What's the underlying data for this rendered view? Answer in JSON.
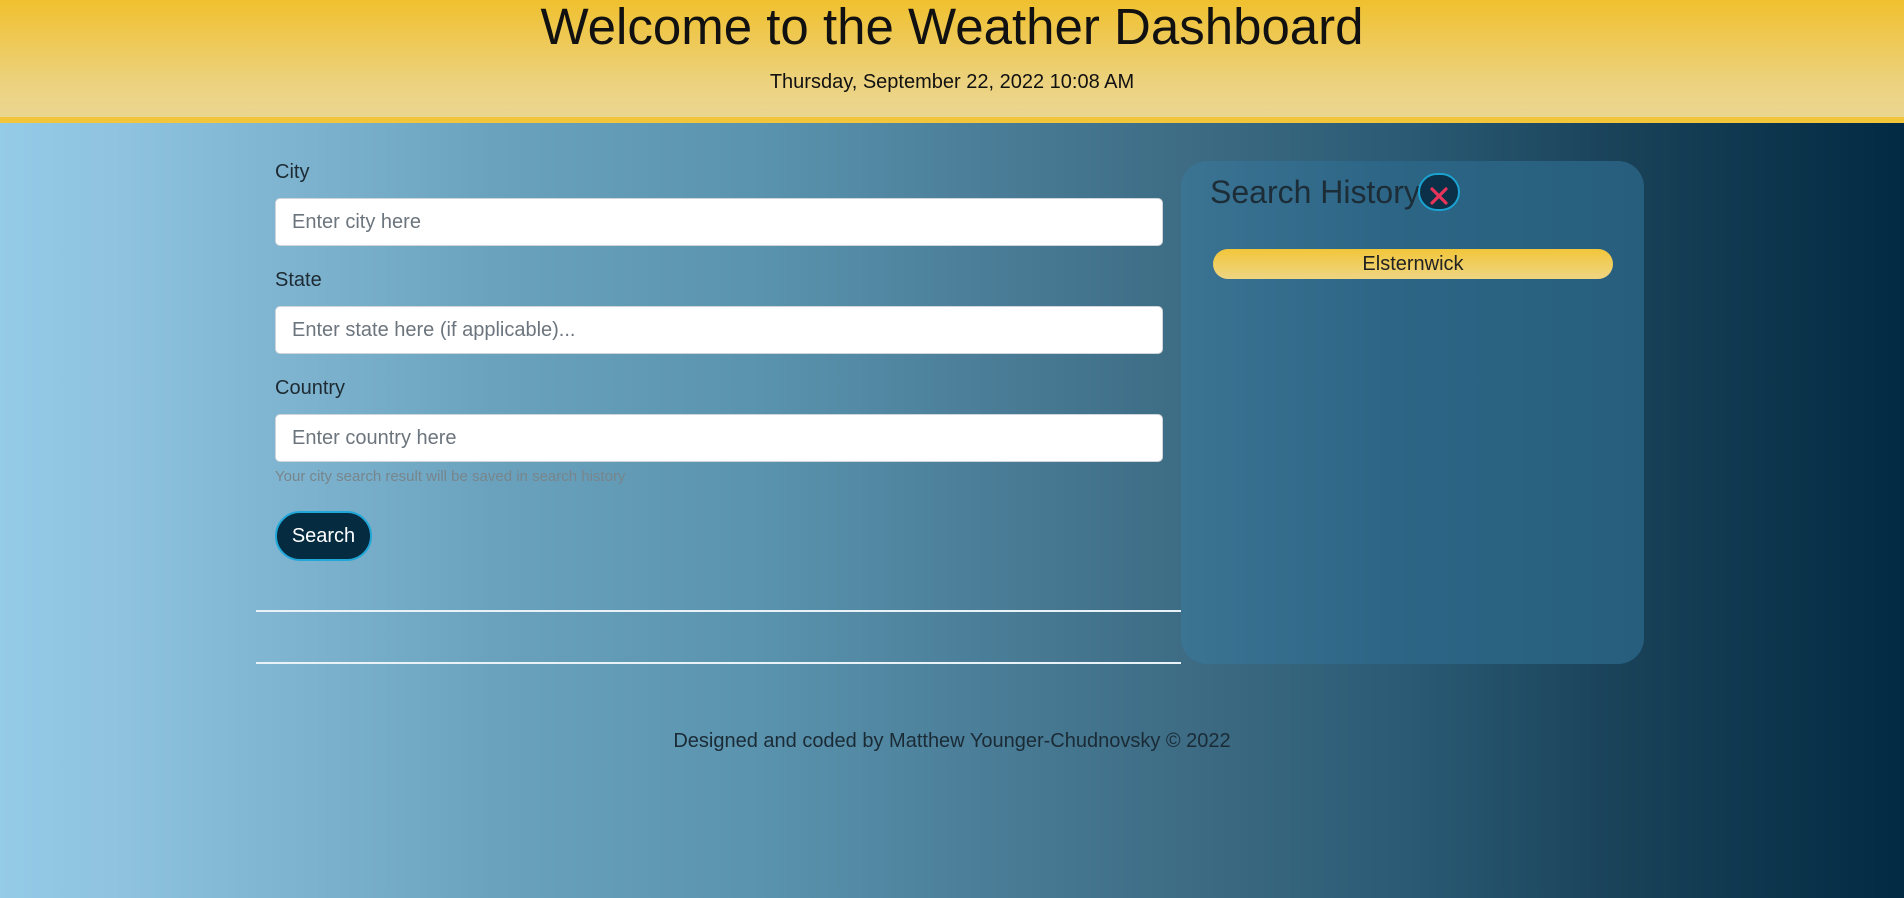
{
  "header": {
    "title": "Welcome to the Weather Dashboard",
    "datetime": "Thursday, September 22, 2022 10:08 AM"
  },
  "form": {
    "city": {
      "label": "City",
      "placeholder": "Enter city here",
      "value": ""
    },
    "state": {
      "label": "State",
      "placeholder": "Enter state here (if applicable)...",
      "value": ""
    },
    "country": {
      "label": "Country",
      "placeholder": "Enter country here",
      "value": ""
    },
    "help_text": "Your city search result will be saved in search history",
    "search_label": "Search"
  },
  "history": {
    "title": "Search History",
    "clear_icon": "close-icon",
    "items": [
      {
        "label": "Elsternwick"
      }
    ]
  },
  "footer": {
    "text": "Designed and coded by Matthew Younger-Chudnovsky © 2022"
  },
  "colors": {
    "header_accent": "#f0c02e",
    "button_bg": "#052b40",
    "button_border": "#20a7d8",
    "clear_icon": "#e8335b",
    "history_item": "#f2c63a"
  }
}
